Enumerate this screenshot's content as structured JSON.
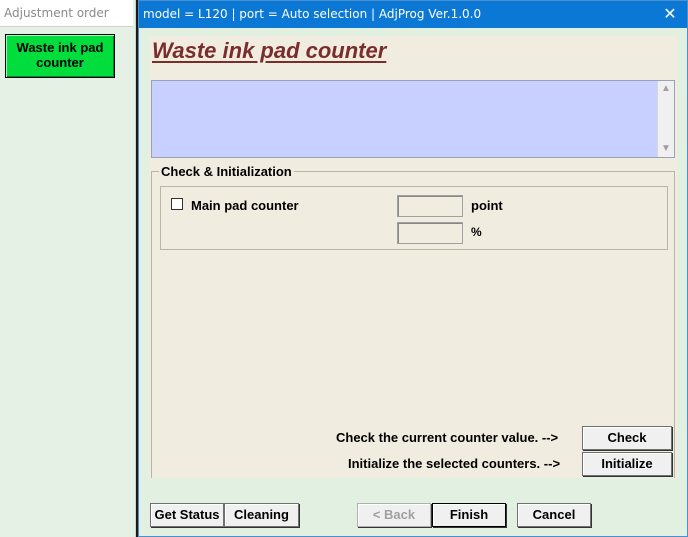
{
  "left_panel": {
    "title": "Adjustment order",
    "items": [
      {
        "label": "Waste ink pad\ncounter"
      }
    ]
  },
  "window": {
    "title": "model = L120 | port = Auto selection | AdjProg Ver.1.0.0",
    "close_symbol": "✕"
  },
  "page": {
    "title": "Waste ink pad counter",
    "log_text": ""
  },
  "group": {
    "legend": "Check & Initialization",
    "counters": [
      {
        "label": "Main pad counter",
        "checked": false,
        "value_point": "",
        "value_percent": "",
        "unit_point": "point",
        "unit_percent": "%"
      }
    ]
  },
  "actions": {
    "check_hint": "Check the current counter value. -->",
    "check_label": "Check",
    "init_hint": "Initialize the selected counters. -->",
    "init_label": "Initialize"
  },
  "footer": {
    "get_status": "Get Status",
    "cleaning": "Cleaning",
    "back": "< Back",
    "finish": "Finish",
    "cancel": "Cancel"
  },
  "colors": {
    "title_bar": "#0a78d4",
    "waste_button": "#00dd3c",
    "page_title": "#7a2d2d",
    "log_background": "#c8d0ff"
  },
  "icons": {
    "close": "close-icon",
    "scroll_up": "chevron-up-icon",
    "scroll_down": "chevron-down-icon"
  }
}
